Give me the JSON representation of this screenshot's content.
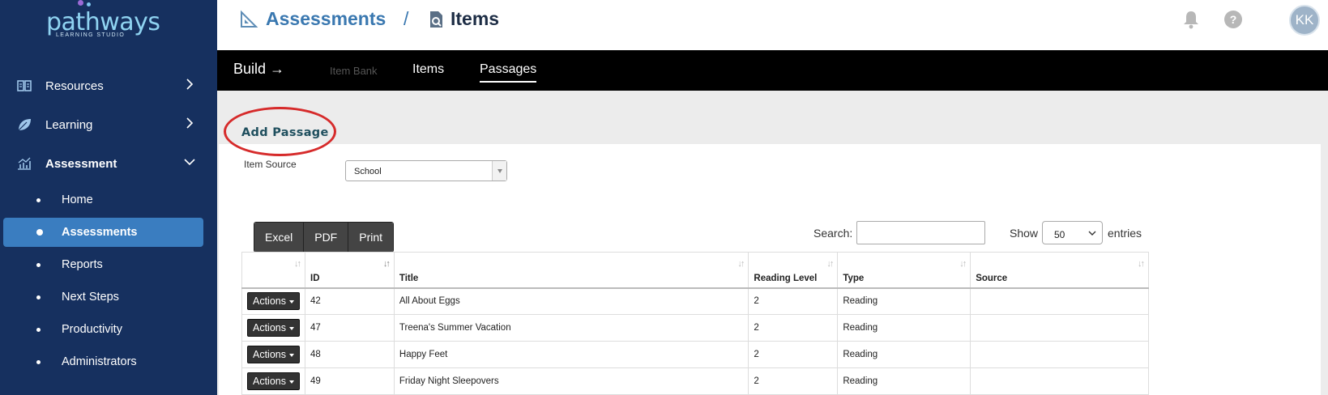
{
  "brand": {
    "name": "pathways",
    "tagline": "LEARNING STUDIO",
    "colors": {
      "sidebar": "#16305f",
      "active": "#3a7dc0",
      "accent": "#3a7dc0"
    }
  },
  "sidebar": {
    "sections": [
      {
        "label": "Resources",
        "icon": "book-icon",
        "expanded": false
      },
      {
        "label": "Learning",
        "icon": "leaf-icon",
        "expanded": false
      },
      {
        "label": "Assessment",
        "icon": "chart-icon",
        "expanded": true
      }
    ],
    "sub_items": [
      {
        "label": "Home",
        "active": false
      },
      {
        "label": "Assessments",
        "active": true
      },
      {
        "label": "Reports",
        "active": false
      },
      {
        "label": "Next Steps",
        "active": false
      },
      {
        "label": "Productivity",
        "active": false
      },
      {
        "label": "Administrators",
        "active": false
      }
    ]
  },
  "header": {
    "breadcrumb_1": "Assessments",
    "separator": "/",
    "breadcrumb_2": "Items",
    "avatar_initials": "KK"
  },
  "toolbar": {
    "build": "Build →",
    "item_bank": "Item Bank",
    "items": "Items",
    "passages": "Passages"
  },
  "main": {
    "add_passage": "Add Passage",
    "item_source_label": "Item Source",
    "item_source_value": "School",
    "export_buttons": [
      "Excel",
      "PDF",
      "Print"
    ],
    "search_label": "Search:",
    "show_label": "Show",
    "show_value": "50",
    "entries_label": "entries",
    "table": {
      "headers": [
        "",
        "ID",
        "Title",
        "Reading Level",
        "Type",
        "Source"
      ],
      "action_label": "Actions",
      "rows": [
        {
          "id": "42",
          "title": "All About Eggs",
          "level": "2",
          "type": "Reading",
          "source": ""
        },
        {
          "id": "47",
          "title": "Treena's Summer Vacation",
          "level": "2",
          "type": "Reading",
          "source": ""
        },
        {
          "id": "48",
          "title": "Happy Feet",
          "level": "2",
          "type": "Reading",
          "source": ""
        },
        {
          "id": "49",
          "title": "Friday Night Sleepovers",
          "level": "2",
          "type": "Reading",
          "source": ""
        }
      ]
    }
  }
}
